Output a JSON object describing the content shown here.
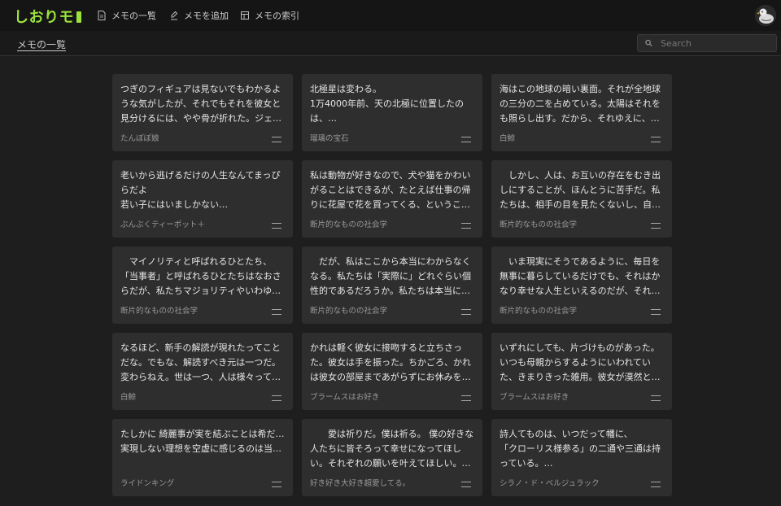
{
  "app": {
    "logo": "しおりモ"
  },
  "nav": [
    {
      "label": "メモの一覧",
      "icon": "document-icon"
    },
    {
      "label": "メモを追加",
      "icon": "edit-icon"
    },
    {
      "label": "メモの索引",
      "icon": "table-icon"
    }
  ],
  "breadcrumb": "メモの一覧",
  "search": {
    "placeholder": "Search"
  },
  "cards": [
    {
      "text": "つぎのフィギュアは見ないでもわかるような気がしたが、それでもそれを彼女と見分けるには、やや骨が折れた。ジェ…",
      "source": "たんぽぽ娘"
    },
    {
      "text": "北極星は変わる。\n1万4000年前、天の北極に位置したのは、…",
      "source": "瑠璃の宝石"
    },
    {
      "text": "海はこの地球の暗い裏面。それが全地球の三分の二を占めている。太陽はそれをも照らし出す。だから、それゆえに、…",
      "source": "白鯨"
    },
    {
      "text": "老いから逃げるだけの人生なんてまっぴらだよ\n若い子にはいましかない…",
      "source": "ぶんぶくティーポット＋"
    },
    {
      "text": "私は動物が好きなので、犬や猫をかわいがることはできるが、たとえば仕事の帰りに花屋で花を買ってくる、というこ…",
      "source": "断片的なものの社会学"
    },
    {
      "text": "　しかし、人は、お互いの存在をむき出しにすることが、ほんとうに苦手だ。私たちは、相手の目を見たくないし、自…",
      "source": "断片的なものの社会学"
    },
    {
      "text": "　マイノリティと呼ばれるひとたち、「当事者」と呼ばれるひとたちはなおさらだが、私たちマジョリティやいわゆ…",
      "source": "断片的なものの社会学"
    },
    {
      "text": "　だが、私はここから本当にわからなくなる。私たちは「実際に」どれぐらい個性的であるだろうか。私たちは本当に…",
      "source": "断片的なものの社会学"
    },
    {
      "text": "　いま現実にそうであるように、毎日を無事に暮らしているだけでも、それはかなり幸せな人生といえるのだが、それ…",
      "source": "断片的なものの社会学"
    },
    {
      "text": "なるほど、新手の解読が現れたってことだな。でもな、解読すべき元は一つだ。変わらねえ。世は一つ、人は様々って…",
      "source": "白鯨"
    },
    {
      "text": "かれは軽く彼女に接吻すると立ちさった。彼女は手を振った。ちかごろ、かれは彼女の部屋まであがらずにお休みを…",
      "source": "ブラームスはお好き"
    },
    {
      "text": "いずれにしても、片づけものがあった。いつも母親からするようにいわれていた、きまりきった雑用。彼女が漠然と…",
      "source": "ブラームスはお好き"
    },
    {
      "text": "たしかに 綺麗事が実を結ぶことは希だ…\n実現しない理想を空虚に感じるのは当…",
      "source": "ライドンキング"
    },
    {
      "text": "　　愛は祈りだ。僕は祈る。 僕の好きな人たちに皆そろって幸せになってほしい。それぞれの願いを叶えてほしい。…",
      "source": "好き好き大好き超愛してる。"
    },
    {
      "text": "詩人てものは、いつだって幡に、\n「クローリス様参る」の二通や三通は持っている。…",
      "source": "シラノ・ド・ベルジュラック"
    }
  ]
}
